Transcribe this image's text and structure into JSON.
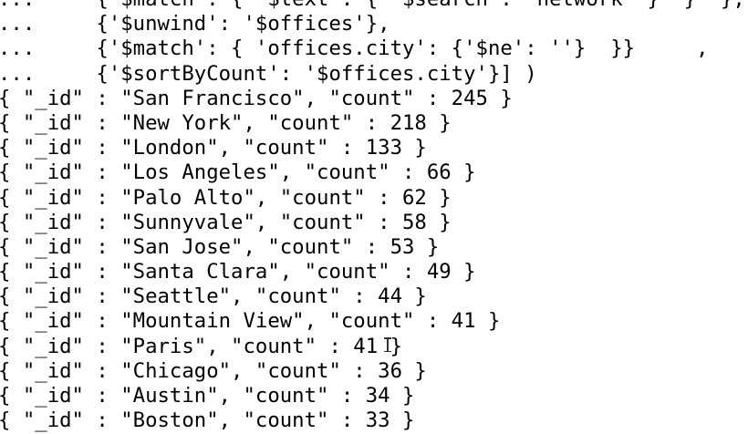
{
  "terminal": {
    "lines": [
      "...     {'$match': { '$text': { '$search': 'network' }  }  },",
      "...     {'$unwind': '$offices'},",
      "...     {'$match': { 'offices.city': {'$ne': ''}  }}     ,",
      "...     {'$sortByCount': '$offices.city'}] )",
      "{ \"_id\" : \"San Francisco\", \"count\" : 245 }",
      "{ \"_id\" : \"New York\", \"count\" : 218 }",
      "{ \"_id\" : \"London\", \"count\" : 133 }",
      "{ \"_id\" : \"Los Angeles\", \"count\" : 66 }",
      "{ \"_id\" : \"Palo Alto\", \"count\" : 62 }",
      "{ \"_id\" : \"Sunnyvale\", \"count\" : 58 }",
      "{ \"_id\" : \"San Jose\", \"count\" : 53 }",
      "{ \"_id\" : \"Santa Clara\", \"count\" : 49 }",
      "{ \"_id\" : \"Seattle\", \"count\" : 44 }",
      "{ \"_id\" : \"Mountain View\", \"count\" : 41 }",
      "{ \"_id\" : \"Paris\", \"count\" : 41 }",
      "{ \"_id\" : \"Chicago\", \"count\" : 36 }",
      "{ \"_id\" : \"Austin\", \"count\" : 34 }",
      "{ \"_id\" : \"Boston\", \"count\" : 33 }"
    ]
  },
  "colors": {
    "background": "#ffffff",
    "text": "#000000"
  },
  "cursor_icon": "i-beam-cursor-icon"
}
